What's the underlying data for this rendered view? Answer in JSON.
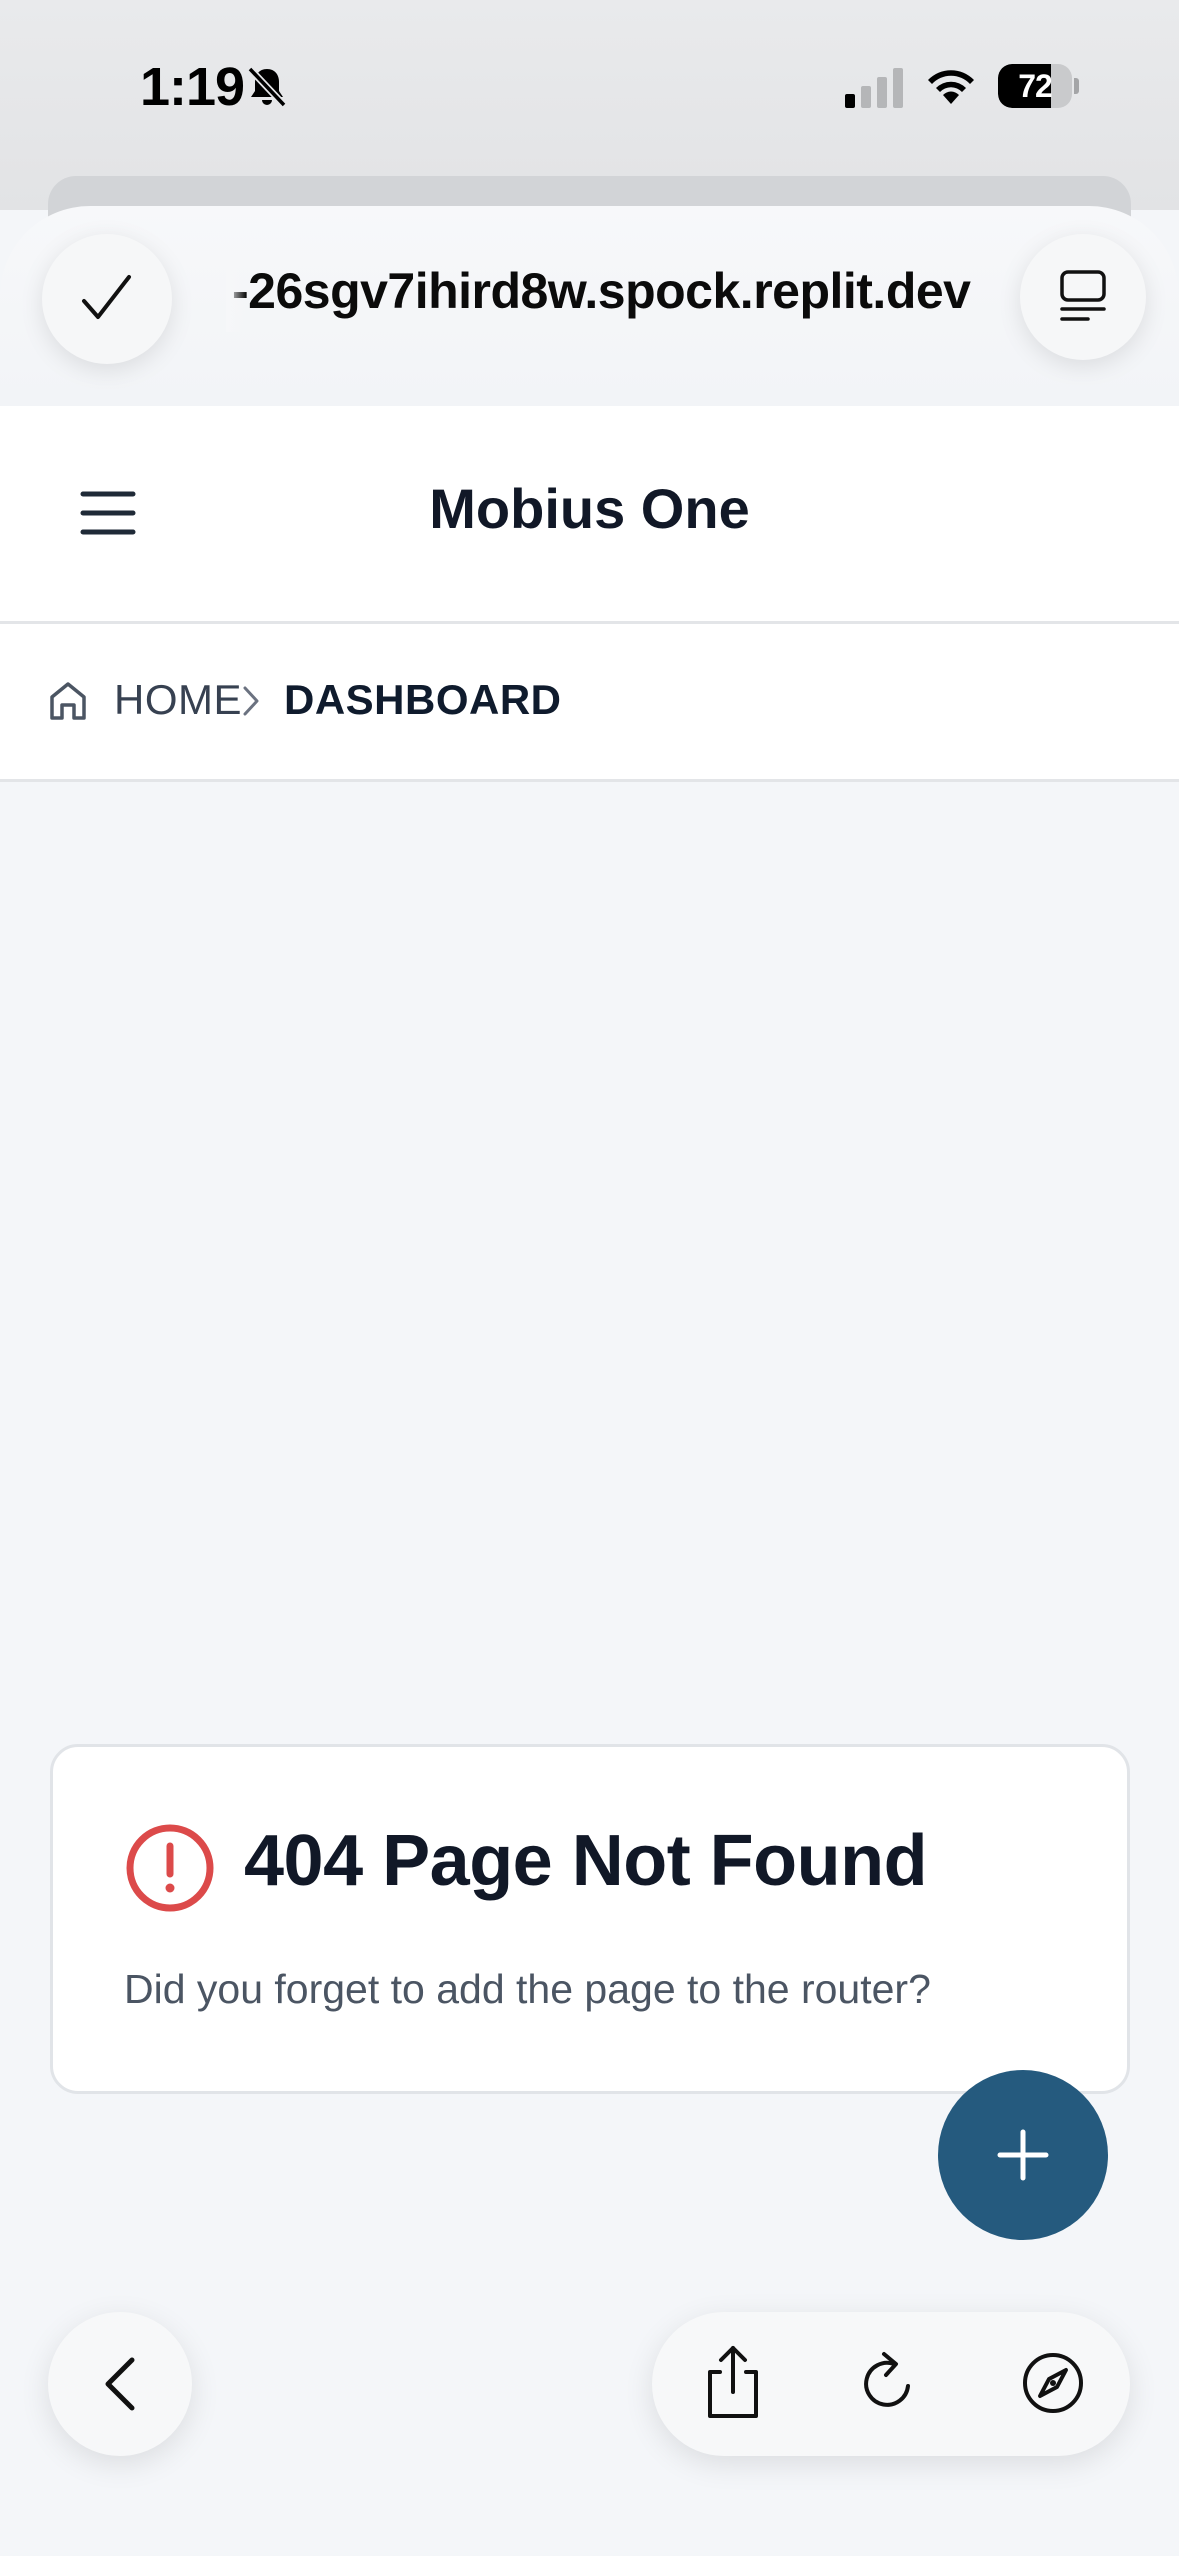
{
  "status_bar": {
    "time": "1:19",
    "battery_percent": "72",
    "battery_level": 0.72,
    "icons": [
      "bell-slash-icon",
      "cellular-signal-icon",
      "wifi-icon",
      "battery-icon"
    ]
  },
  "browser": {
    "url": "-26sgv7ihird8w.spock.replit.dev",
    "icons": [
      "checkmark-icon",
      "tab-overview-icon"
    ]
  },
  "app": {
    "title": "Mobius One",
    "menu_icon": "hamburger-menu-icon"
  },
  "breadcrumb": {
    "home_label": "HOME",
    "current_label": "DASHBOARD",
    "icons": [
      "home-icon",
      "chevron-right-icon"
    ]
  },
  "error_card": {
    "title": "404 Page Not Found",
    "message": "Did you forget to add the page to the router?",
    "icon": "alert-circle-icon",
    "icon_color": "#dc4a4a"
  },
  "fab": {
    "icon": "plus-icon",
    "color": "#255a7e"
  },
  "bottom_toolbar": {
    "icons": [
      "back-chevron-icon",
      "share-icon",
      "reload-icon",
      "compass-icon"
    ]
  }
}
